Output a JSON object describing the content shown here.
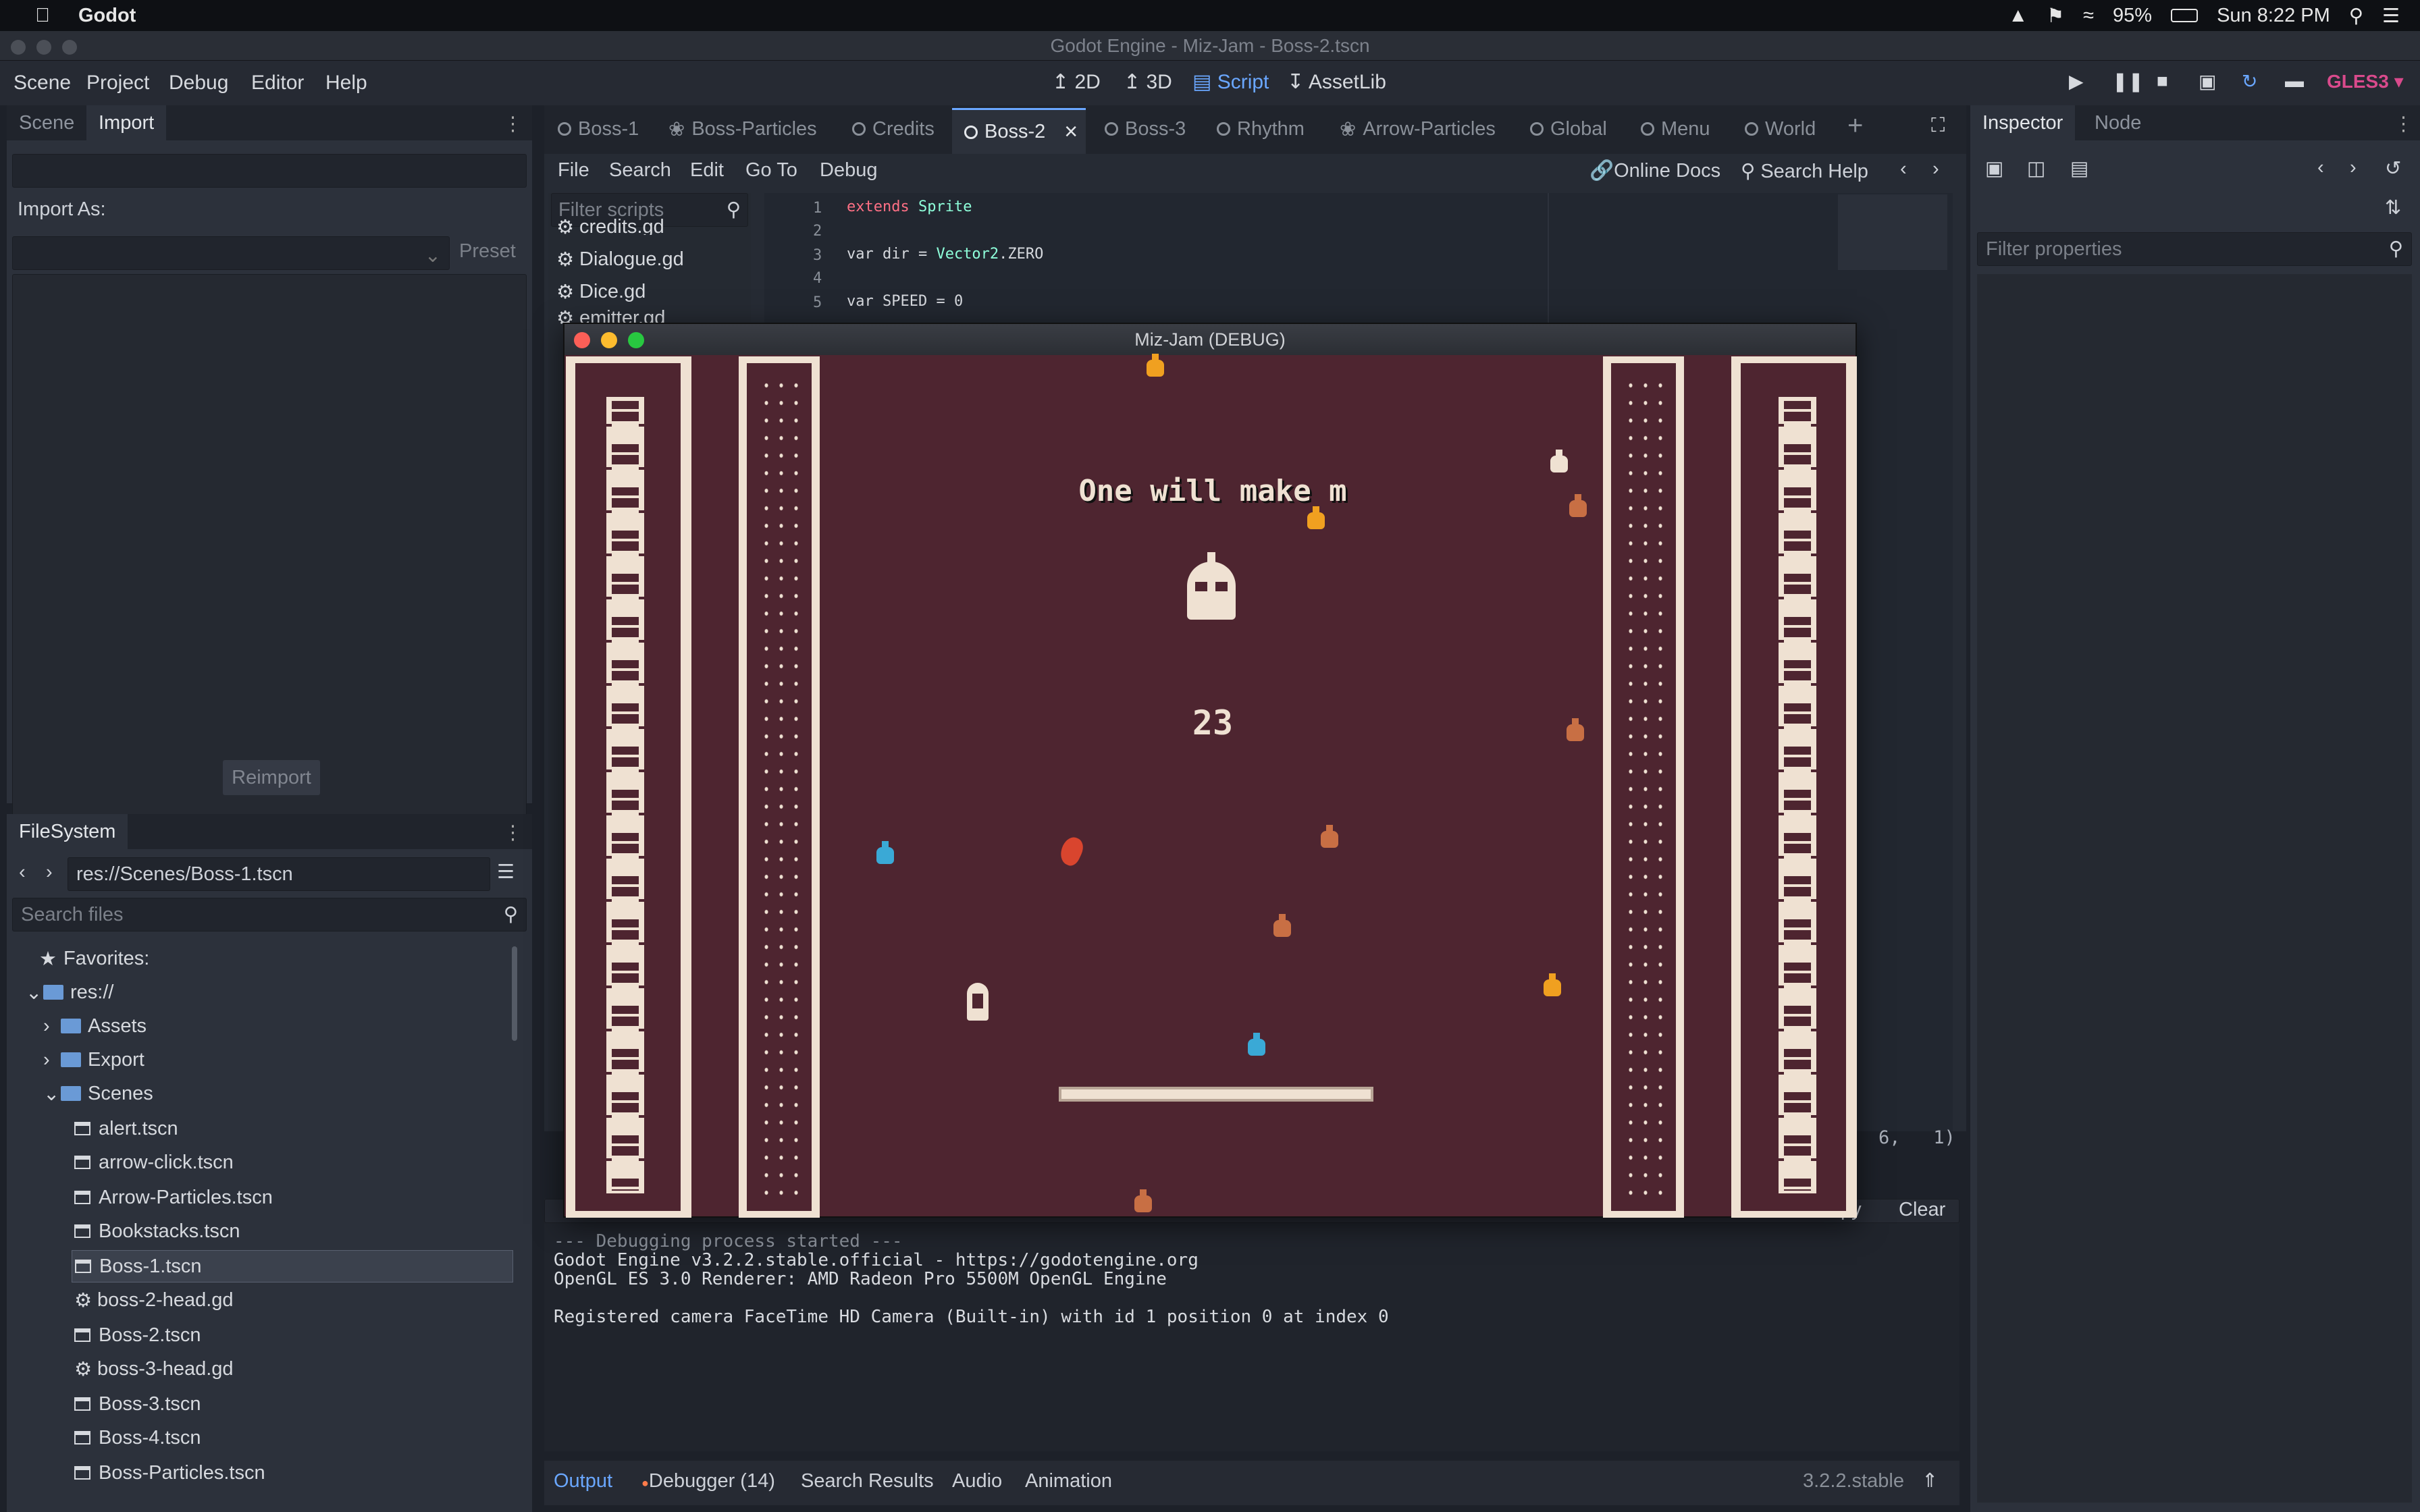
{
  "mac_menubar": {
    "app": "Godot",
    "battery": "95%",
    "clock": "Sun 8:22 PM"
  },
  "window": {
    "title": "Godot Engine - Miz-Jam - Boss-2.tscn"
  },
  "menu": {
    "items": [
      "Scene",
      "Project",
      "Debug",
      "Editor",
      "Help"
    ]
  },
  "workspaces": {
    "w2d": "2D",
    "w3d": "3D",
    "script": "Script",
    "assetlib": "AssetLib"
  },
  "renderer": "GLES3",
  "left_dock": {
    "tab_scene": "Scene",
    "tab_import": "Import",
    "import_as": "Import As:",
    "preset": "Preset",
    "reimport": "Reimport"
  },
  "filesystem": {
    "title": "FileSystem",
    "path": "res://Scenes/Boss-1.tscn",
    "search_placeholder": "Search files",
    "favorites": "Favorites:",
    "root": "res://",
    "folders": [
      "Assets",
      "Export",
      "Scenes"
    ],
    "files": [
      "alert.tscn",
      "arrow-click.tscn",
      "Arrow-Particles.tscn",
      "Bookstacks.tscn",
      "Boss-1.tscn",
      "boss-2-head.gd",
      "Boss-2.tscn",
      "boss-3-head.gd",
      "Boss-3.tscn",
      "Boss-4.tscn",
      "Boss-Particles.tscn"
    ],
    "selected": "Boss-1.tscn"
  },
  "scene_tabs": [
    "Boss-1",
    "Boss-Particles",
    "Credits",
    "Boss-2",
    "Boss-3",
    "Rhythm",
    "Arrow-Particles",
    "Global",
    "Menu",
    "World"
  ],
  "active_scene_tab": "Boss-2",
  "script_menu": {
    "file": "File",
    "search": "Search",
    "edit": "Edit",
    "goto": "Go To",
    "debug": "Debug",
    "online_docs": "Online Docs",
    "search_help": "Search Help"
  },
  "script_list": {
    "filter_placeholder": "Filter scripts",
    "items": [
      "credits.gd",
      "Dialogue.gd",
      "Dice.gd",
      "emitter.gd"
    ]
  },
  "code": {
    "line_numbers": [
      "1",
      "2",
      "3",
      "4",
      "5"
    ],
    "l1a": "extends",
    "l1b": "Sprite",
    "l3a": "var dir = ",
    "l3b": "Vector2",
    "l3c": ".ZERO",
    "l5": "var SPEED = 0"
  },
  "cursor_pos": "6,   1)",
  "game": {
    "title": "Miz-Jam (DEBUG)",
    "dialogue": "One will make m",
    "counter": "23"
  },
  "console": {
    "copy": "py",
    "clear": "Clear",
    "lines": [
      "--- Debugging process started ---",
      "Godot Engine v3.2.2.stable.official - https://godotengine.org",
      "OpenGL ES 3.0 Renderer: AMD Radeon Pro 5500M OpenGL Engine",
      "",
      "Registered camera FaceTime HD Camera (Built-in) with id 1 position 0 at index 0"
    ]
  },
  "bottom_tabs": {
    "output": "Output",
    "debugger": "Debugger (14)",
    "search_results": "Search Results",
    "audio": "Audio",
    "animation": "Animation",
    "version": "3.2.2.stable"
  },
  "inspector": {
    "tab_inspector": "Inspector",
    "tab_node": "Node",
    "filter_placeholder": "Filter properties"
  },
  "colors": {
    "accent": "#6aa7ff",
    "game_bg": "#4e2530",
    "pillar": "#efe1d2",
    "renderer": "#d94a8c"
  }
}
